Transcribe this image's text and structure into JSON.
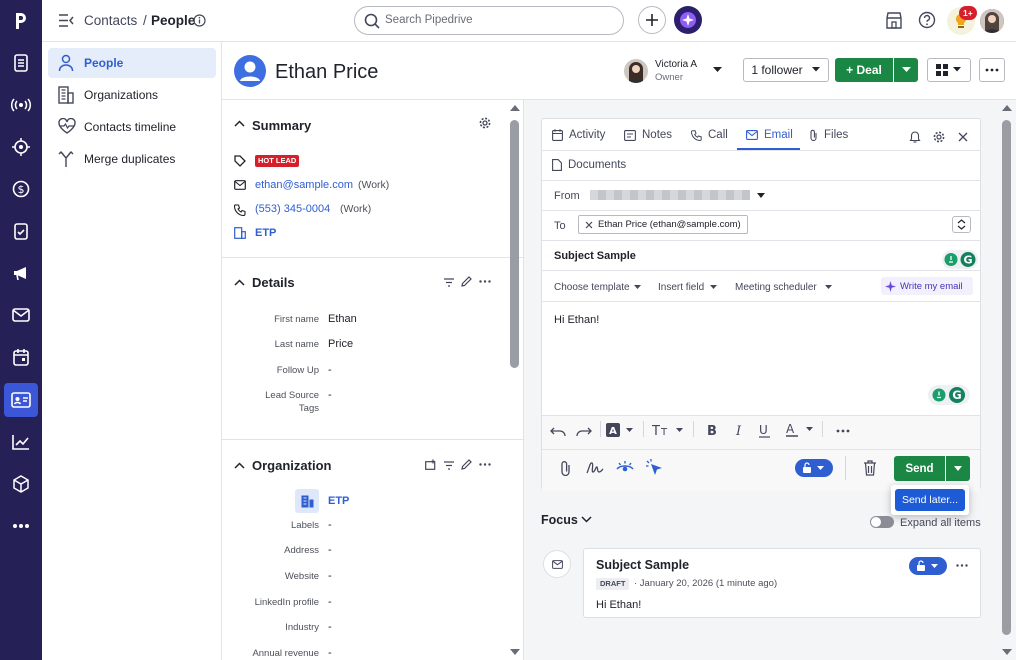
{
  "topbar": {
    "breadcrumb_contacts": "Contacts",
    "breadcrumb_sep": "/",
    "breadcrumb_people": "People",
    "search_placeholder": "Search Pipedrive",
    "notif_badge": "1+"
  },
  "subnav": {
    "items": [
      {
        "label": "People",
        "icon": "person-icon"
      },
      {
        "label": "Organizations",
        "icon": "building-icon"
      },
      {
        "label": "Contacts timeline",
        "icon": "heart-pulse-icon"
      },
      {
        "label": "Merge duplicates",
        "icon": "merge-icon"
      }
    ]
  },
  "header": {
    "person_name": "Ethan Price",
    "owner_name": "Victoria A",
    "owner_role": "Owner",
    "follower_label": "1 follower",
    "deal_label": "+ Deal"
  },
  "summary": {
    "title": "Summary",
    "tag": "HOT LEAD",
    "email": "ethan@sample.com",
    "email_type": "(Work)",
    "phone": "(553) 345-0004",
    "phone_type": "(Work)",
    "org": "ETP"
  },
  "details": {
    "title": "Details",
    "fields": [
      {
        "label": "First name",
        "value": "Ethan"
      },
      {
        "label": "Last name",
        "value": "Price"
      },
      {
        "label": "Follow Up",
        "value": "-"
      },
      {
        "label": "Lead Source",
        "label2": "Tags",
        "value": "-"
      }
    ]
  },
  "organization": {
    "title": "Organization",
    "name": "ETP",
    "fields": [
      {
        "label": "Labels",
        "value": "-"
      },
      {
        "label": "Address",
        "value": "-"
      },
      {
        "label": "Website",
        "value": "-"
      },
      {
        "label": "LinkedIn profile",
        "value": "-"
      },
      {
        "label": "Industry",
        "value": "-"
      },
      {
        "label": "Annual revenue",
        "value": "-"
      }
    ]
  },
  "composer": {
    "tabs": [
      "Activity",
      "Notes",
      "Call",
      "Email",
      "Files",
      "Documents"
    ],
    "from_label": "From",
    "to_label": "To",
    "to_recipient": "Ethan Price (ethan@sample.com)",
    "subject": "Subject Sample",
    "toolbar": [
      "Choose template",
      "Insert field",
      "Meeting scheduler"
    ],
    "write_ai": "Write my email",
    "body": "Hi Ethan!",
    "send_label": "Send",
    "send_later": "Send later..."
  },
  "focus": {
    "title": "Focus",
    "expand_label": "Expand all items"
  },
  "timeline": {
    "subject": "Subject Sample",
    "badge": "DRAFT",
    "date": "· January 20, 2026 (1 minute ago)",
    "body": "Hi Ethan!"
  },
  "colors": {
    "rail": "#252156",
    "accent": "#2f5ed0",
    "green": "#1a8744",
    "hot": "#d5202b"
  }
}
